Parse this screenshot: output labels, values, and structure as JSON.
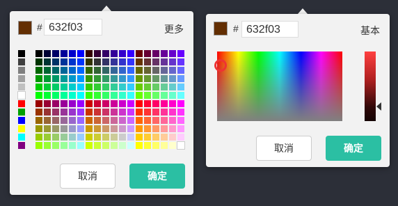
{
  "left_picker": {
    "current_color": "#632f03",
    "hex_label": "#",
    "hex_value": "632f03",
    "mode_toggle": "更多",
    "cancel_label": "取消",
    "ok_label": "确定",
    "basic_colors": [
      "#000000",
      "#404040",
      "#808080",
      "#a0a0a0",
      "#c0c0c0",
      "#ffffff",
      "#ff0000",
      "#00a000",
      "#0000ff",
      "#ffff00",
      "#00ffff",
      "#800080"
    ],
    "palette_rows": 12,
    "palette_cols": 18
  },
  "right_picker": {
    "current_color": "#632f03",
    "hex_label": "#",
    "hex_value": "632f03",
    "mode_toggle": "基本",
    "cancel_label": "取消",
    "ok_label": "确定"
  },
  "accent_color": "#2bbfa3"
}
